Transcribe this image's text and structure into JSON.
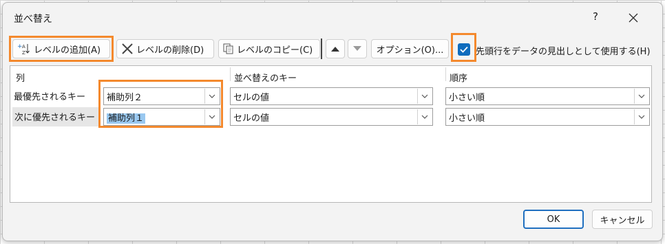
{
  "dialog": {
    "title": "並べ替え",
    "help": "?",
    "close_icon": "close-icon"
  },
  "toolbar": {
    "add_level": "レベルの追加(A)",
    "delete_level": "レベルの削除(D)",
    "copy_level": "レベルのコピー(C)",
    "move_up_icon": "triangle-up-icon",
    "move_down_icon": "triangle-down-icon",
    "options": "オプション(O)...",
    "header_checkbox_label": "先頭行をデータの見出しとして使用する(H)",
    "header_checkbox_checked": true
  },
  "grid": {
    "headers": {
      "column": "列",
      "sort_on": "並べ替えのキー",
      "order": "順序"
    },
    "rows": [
      {
        "label": "最優先されるキー",
        "column": "補助列２",
        "sort_on": "セルの値",
        "order": "小さい順"
      },
      {
        "label": "次に優先されるキー",
        "column": "補助列１",
        "sort_on": "セルの値",
        "order": "小さい順"
      }
    ]
  },
  "buttons": {
    "ok": "OK",
    "cancel": "キャンセル"
  },
  "colors": {
    "accent": "#0f6cbd",
    "highlight": "#f4892d",
    "selection": "#99c8f0"
  }
}
